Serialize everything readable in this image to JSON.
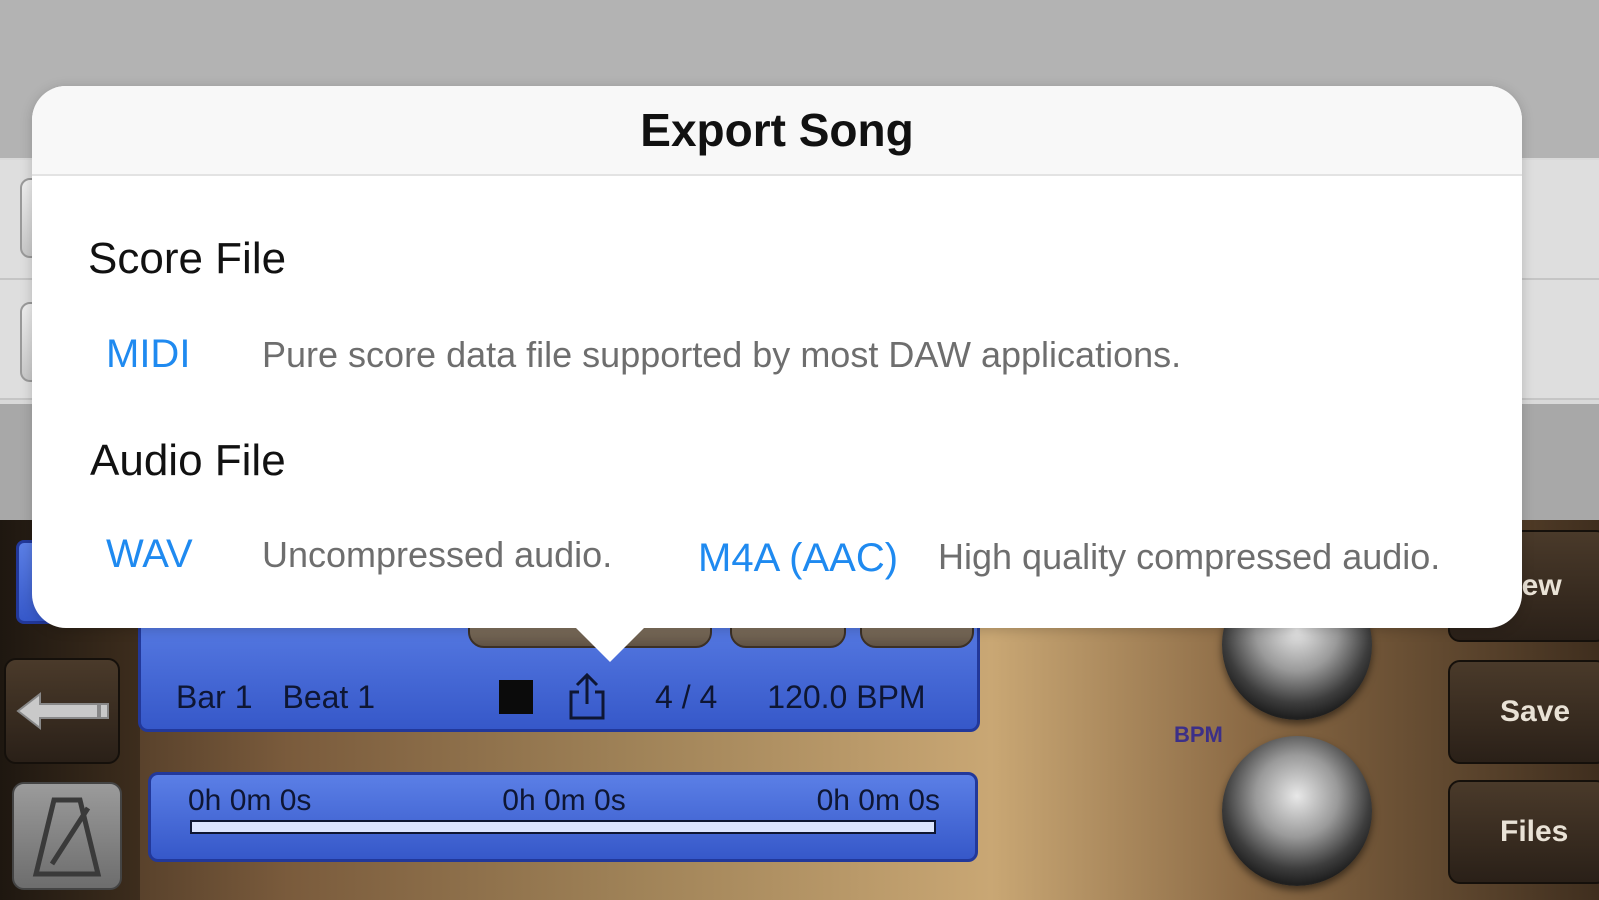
{
  "dialog": {
    "title": "Export Song",
    "score_section": {
      "heading": "Score File",
      "options": [
        {
          "label": "MIDI",
          "description": "Pure score data file supported by most DAW applications."
        }
      ]
    },
    "audio_section": {
      "heading": "Audio File",
      "options": [
        {
          "label": "WAV",
          "description": "Uncompressed audio."
        },
        {
          "label": "M4A (AAC)",
          "description": "High quality compressed audio."
        }
      ]
    }
  },
  "transport": {
    "bar": "Bar 1",
    "beat": "Beat 1",
    "time_signature": "4 / 4",
    "tempo": "120.0 BPM"
  },
  "timeline": {
    "start": "0h 0m 0s",
    "current": "0h 0m 0s",
    "end": "0h 0m 0s"
  },
  "knobs": {
    "bpm_label": "BPM"
  },
  "side_buttons": {
    "new": "New",
    "save": "Save",
    "files": "Files"
  },
  "icons": {
    "stop": "stop-icon",
    "share": "share-icon",
    "back": "back-arrow-icon",
    "metronome": "metronome-icon"
  },
  "colors": {
    "link_blue": "#1f8af0",
    "panel_blue": "#4a6ddb"
  }
}
